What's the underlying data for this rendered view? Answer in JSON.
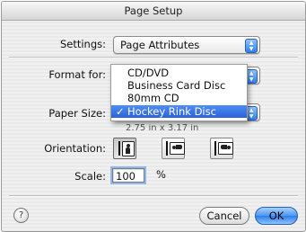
{
  "window": {
    "title": "Page Setup"
  },
  "settings": {
    "label": "Settings:",
    "value": "Page Attributes"
  },
  "format_for": {
    "label": "Format for:",
    "value": ""
  },
  "paper_size": {
    "label": "Paper Size:",
    "subtext": "2.75 in x 3.17 in"
  },
  "paper_menu": {
    "items": [
      {
        "label": "CD/DVD",
        "checked": false
      },
      {
        "label": "Business Card Disc",
        "checked": false
      },
      {
        "label": "80mm CD",
        "checked": false
      },
      {
        "label": "Hockey Rink Disc",
        "checked": true
      }
    ],
    "check_glyph": "✓"
  },
  "orientation": {
    "label": "Orientation:",
    "selected_index": 0
  },
  "scale": {
    "label": "Scale:",
    "value": "100",
    "unit": "%"
  },
  "buttons": {
    "help": "?",
    "cancel": "Cancel",
    "ok": "OK"
  },
  "colors": {
    "accent": "#2d7ee8"
  }
}
